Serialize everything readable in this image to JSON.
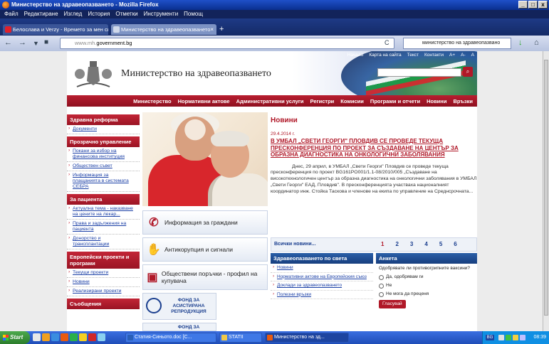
{
  "window": {
    "title": "Министерство на здравеопазването - Mozilla Firefox",
    "buttons": [
      "_",
      "□",
      "x"
    ]
  },
  "menu": [
    "Файл",
    "Редактиране",
    "Изглед",
    "История",
    "Отметки",
    "Инструменти",
    "Помощ"
  ],
  "tabs": [
    {
      "label": "Белослава и Verzy - Времето за мен си ...",
      "active": false
    },
    {
      "label": "Министерство на здравеопазването",
      "active": true
    }
  ],
  "address": {
    "prefix": "www.mh.",
    "domain": "government.bg"
  },
  "search_engine": {
    "value": "министерство на здравеопазвано"
  },
  "site": {
    "toplinks": [
      "Начало",
      "Карта на сайта",
      "Текст",
      "Контакти",
      "A+",
      "A-",
      "A"
    ],
    "title": "Министерство на здравеопазването",
    "nav": [
      "Министерство",
      "Нормативни актове",
      "Административни услуги",
      "Регистри",
      "Комисии",
      "Програми и отчети",
      "Новини",
      "Връзки"
    ]
  },
  "sidebar": {
    "sections": [
      {
        "head": "Здравна реформа",
        "items": [
          "Документи"
        ]
      },
      {
        "head": "Прозрачно управление",
        "items": [
          "Покани за избор на финансова институция",
          "Обществен съвет",
          "Информация за плащанията в системата СЕБРА"
        ]
      },
      {
        "head": "За пациента",
        "items": [
          "Актуална тема - наказване на цените на лекар...",
          "Права и задължения на пациента",
          "Донорство и трансплантации"
        ]
      },
      {
        "head": "Европейски проекти и програми",
        "items": [
          "Текущи проекти",
          "Новини",
          "Реализирани проекти"
        ]
      },
      {
        "head": "Съобщения",
        "items": []
      }
    ]
  },
  "infoboxes": [
    {
      "icon": "phone-icon",
      "label": "Информация за граждани"
    },
    {
      "icon": "hand-icon",
      "label": "Антикорупция и сигнали"
    },
    {
      "icon": "presentation-icon",
      "label": "Обществени поръчки - профил на купувача"
    }
  ],
  "fund": {
    "label": "ФОНД ЗА АСИСТИРАНА РЕПРОДУКЦИЯ",
    "label2": "ФОНД ЗА"
  },
  "news": {
    "heading": "Новини",
    "date": "29.4.2014 г.",
    "headline": "В УМБАЛ „СВЕТИ ГЕОРГИ\" ПЛОВДИВ СЕ ПРОВЕДЕ ТЕКУЩА ПРЕСКОНФЕРЕНЦИЯ ПО ПРОЕКТ ЗА СЪЗДАВАНЕ НА ЦЕНТЪР ЗА ОБРАЗНА ДИАГНОСТИКА НА ОНКОЛОГИЧНИ ЗАБОЛЯВАНИЯ",
    "body": "Днес, 29 април, в УМБАЛ „Свети Георги\" Пловдив се проведе текуща пресконференция по проект BG161PO001/1.1-08/2010/005 „Създаване на високотехнологичен център за образна диагностика на онкологични заболявания в УМБАЛ „Свети Георги\" ЕАД, Пловдив\". В пресконференцията участваха националният координатор инж. Стойка Таскова и членове на екипа по управление на Среднсрочната...",
    "all_news": "Всички новини...",
    "pages": [
      "1",
      "2",
      "3",
      "4",
      "5",
      "6"
    ],
    "active_page": "1"
  },
  "world_health": {
    "head": "Здравеопазването по света",
    "links": [
      "Новини",
      "Нормативни актове на Европейския съюз",
      "Доклади за здравеопазването",
      "Полезни връзки"
    ]
  },
  "poll": {
    "head": "Анкета",
    "question": "Одобрявате ли противогрипните ваксини?",
    "options": [
      "Да, одобрявам ги",
      "Не",
      "Не мога да преценя"
    ],
    "vote": "Гласувай"
  },
  "taskbar": {
    "start": "Start",
    "buttons": [
      {
        "label": "Статия-Синьото.doc [C...",
        "active": false
      },
      {
        "label": "STATII",
        "active": false
      },
      {
        "label": "Министерство на зд...",
        "active": true
      }
    ],
    "time": "08:39",
    "lang": "BG"
  }
}
